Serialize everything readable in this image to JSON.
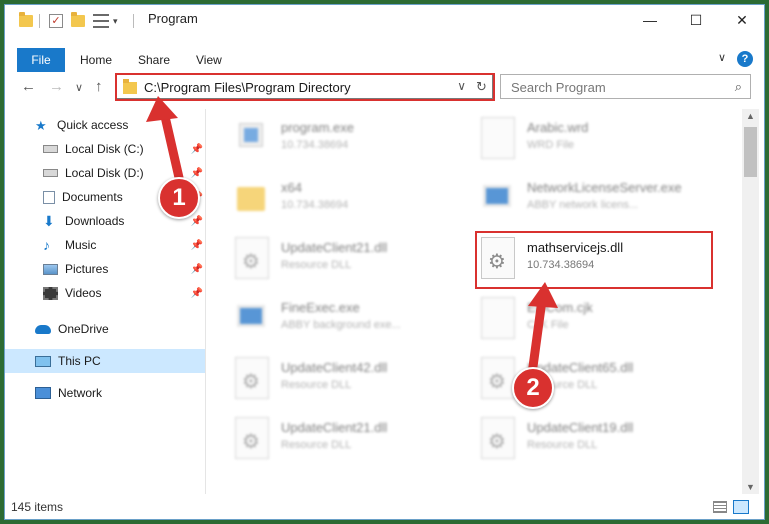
{
  "window": {
    "title": "Program",
    "controls": {
      "minimize": "—",
      "maximize": "☐",
      "close": "✕"
    }
  },
  "ribbon": {
    "tabs": [
      "File",
      "Home",
      "Share",
      "View"
    ],
    "help": "?"
  },
  "address_bar": {
    "path": "C:\\Program Files\\Program Directory",
    "dropdown": "∨",
    "refresh": "↻"
  },
  "search": {
    "placeholder": "Search Program",
    "icon": "⌕"
  },
  "nav_buttons": {
    "back": "←",
    "forward": "→",
    "recent": "∨",
    "up": "↑"
  },
  "sidebar": {
    "items": [
      {
        "label": "Quick access",
        "icon": "star-icon"
      },
      {
        "label": "Local Disk (C:)",
        "icon": "drive-icon"
      },
      {
        "label": "Local Disk (D:)",
        "icon": "drive-icon"
      },
      {
        "label": "Documents",
        "icon": "documents-icon"
      },
      {
        "label": "Downloads",
        "icon": "downloads-icon"
      },
      {
        "label": "Music",
        "icon": "music-icon"
      },
      {
        "label": "Pictures",
        "icon": "pictures-icon"
      },
      {
        "label": "Videos",
        "icon": "videos-icon"
      },
      {
        "label": "OneDrive",
        "icon": "cloud-icon"
      },
      {
        "label": "This PC",
        "icon": "computer-icon"
      },
      {
        "label": "Network",
        "icon": "network-icon"
      }
    ]
  },
  "files": [
    {
      "name": "program.exe",
      "sub": "10.734.38694"
    },
    {
      "name": "Arabic.wrd",
      "sub": "WRD File"
    },
    {
      "name": "x64",
      "sub": "10.734.38694"
    },
    {
      "name": "NetworkLicenseServer.exe",
      "sub": "ABBY network licens..."
    },
    {
      "name": "UpdateClient21.dll",
      "sub": "Resource DLL"
    },
    {
      "name": "mathservicejs.dll",
      "sub": "10.734.38694"
    },
    {
      "name": "FineExec.exe",
      "sub": "ABBY background exe..."
    },
    {
      "name": "EulCom.cjk",
      "sub": "CJK File"
    },
    {
      "name": "UpdateClient42.dll",
      "sub": "Resource DLL"
    },
    {
      "name": "UpdateClient65.dll",
      "sub": "Resource DLL"
    },
    {
      "name": "UpdateClient21.dll",
      "sub": "Resource DLL"
    },
    {
      "name": "UpdateClient19.dll",
      "sub": "Resource DLL"
    }
  ],
  "status": {
    "items_count": "145 items"
  },
  "annotations": {
    "step1": "1",
    "step2": "2"
  },
  "colors": {
    "accent": "#1979ca",
    "annotation": "#d9312f",
    "selected": "#cce8ff"
  }
}
